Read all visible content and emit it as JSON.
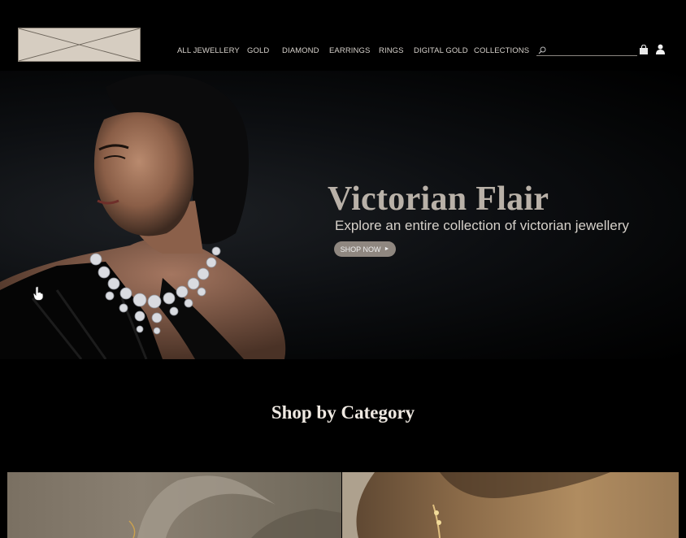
{
  "nav": {
    "items": [
      {
        "label": "ALL JEWELLERY"
      },
      {
        "label": "GOLD"
      },
      {
        "label": "DIAMOND"
      },
      {
        "label": "EARRINGS"
      },
      {
        "label": "RINGS"
      },
      {
        "label": "DIGITAL GOLD"
      },
      {
        "label": "COLLECTIONS"
      }
    ]
  },
  "search": {
    "placeholder": "",
    "icon": "search-icon"
  },
  "icons": {
    "cart": "shopping-bag-icon",
    "user": "user-icon",
    "cursor": "hand-pointer-icon"
  },
  "hero": {
    "title": "Victorian Flair",
    "subtitle": "Explore an entire collection of victorian jewellery",
    "cta_label": "SHOP NOW",
    "cta_arrow": "►"
  },
  "category": {
    "title": "Shop by Category"
  },
  "colors": {
    "background": "#000000",
    "hero_title": "#b9b1a8",
    "cta_bg": "#8f8780",
    "logo_placeholder": "#d6cdc1"
  }
}
